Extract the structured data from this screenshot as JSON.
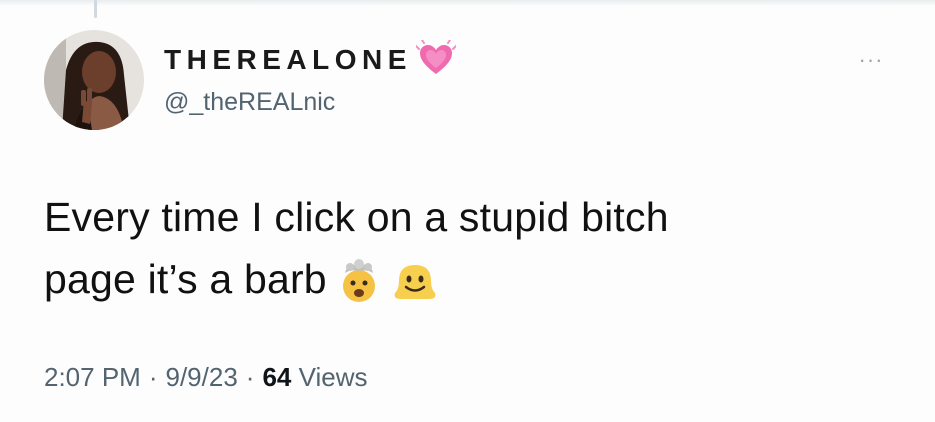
{
  "user": {
    "display_name": "THEREALONE",
    "handle": "@_theREALnic",
    "badge_icon": "growing-heart-icon",
    "avatar_icon": "profile-photo"
  },
  "tweet": {
    "text_line1": "Every time I click on a stupid bitch",
    "text_line2": "page it’s a barb",
    "emojis": [
      "exploding-head-icon",
      "melting-face-icon"
    ]
  },
  "meta": {
    "time": "2:07 PM",
    "separator": "·",
    "date": "9/9/23",
    "views_count": "64",
    "views_label": "Views"
  },
  "actions": {
    "more_icon": "more-options-icon",
    "more_label": "···"
  },
  "colors": {
    "secondary_text": "#536471",
    "primary_text": "#0f1419",
    "heart": "#f06ab0"
  }
}
